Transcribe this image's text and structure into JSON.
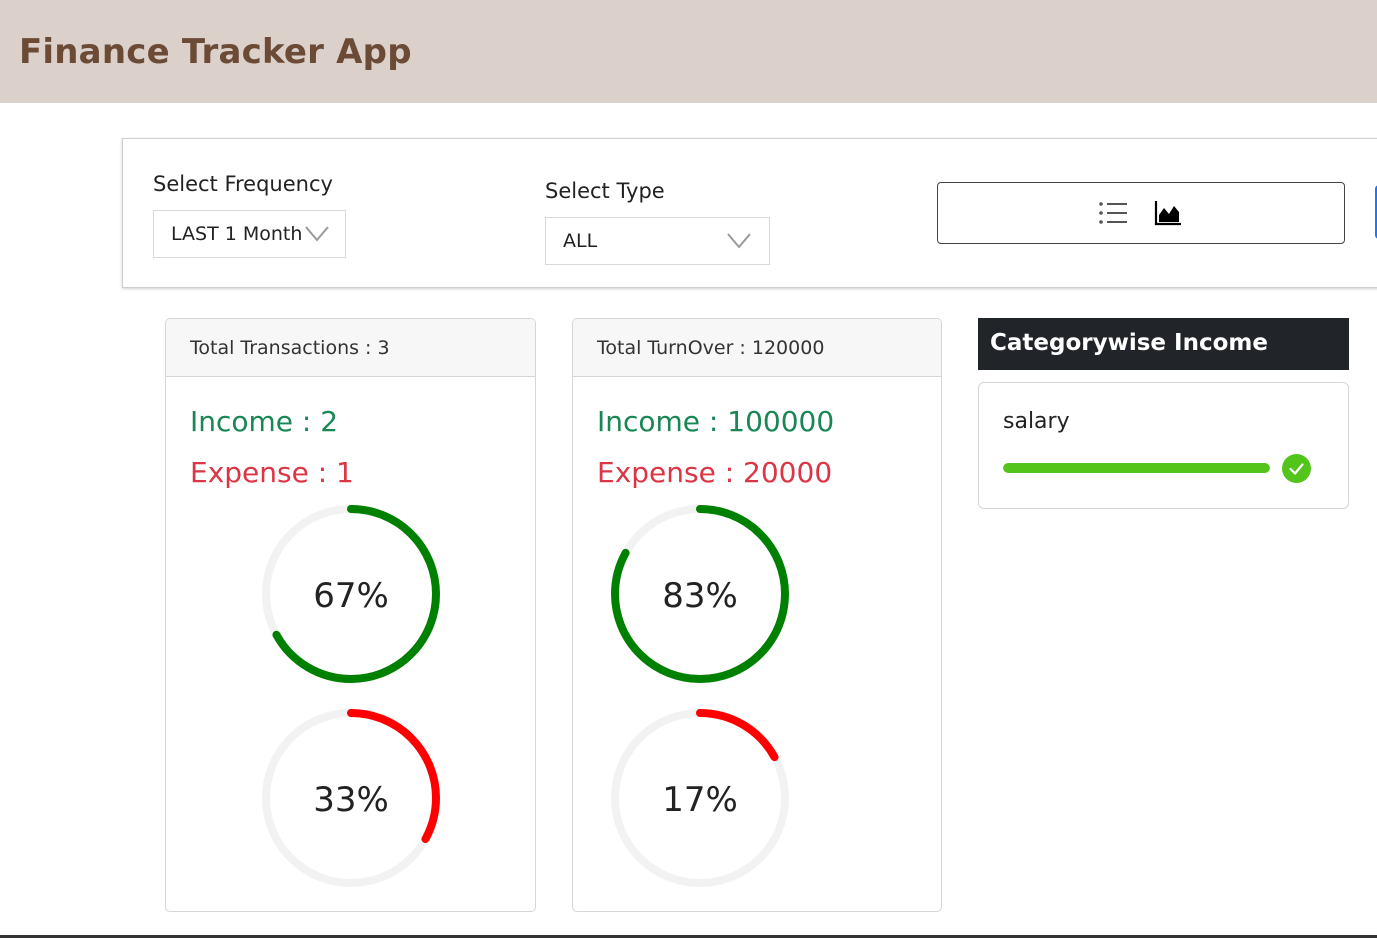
{
  "header": {
    "title": "Finance Tracker App"
  },
  "filters": {
    "frequency_label": "Select Frequency",
    "frequency_value": "LAST 1 Month",
    "type_label": "Select Type",
    "type_value": "ALL",
    "view_icons": [
      "unordered-list-icon",
      "area-chart-icon"
    ]
  },
  "transactions_card": {
    "header": "Total Transactions : 3",
    "income": "Income : 2",
    "expense": "Expense : 1",
    "income_percent": 67,
    "income_percent_label": "67%",
    "expense_percent": 33,
    "expense_percent_label": "33%"
  },
  "turnover_card": {
    "header": "Total TurnOver : 120000",
    "income": "Income : 100000",
    "expense": "Expense : 20000",
    "income_percent": 83,
    "income_percent_label": "83%",
    "expense_percent": 17,
    "expense_percent_label": "17%"
  },
  "category_income": {
    "title": "Categorywise Income",
    "items": [
      {
        "name": "salary",
        "percent": 100
      }
    ]
  },
  "colors": {
    "income_ring": "#008000",
    "expense_ring": "#ff0000",
    "ring_track": "#f2f2f2",
    "income_text": "#198754",
    "expense_text": "#dc3545",
    "category_bar": "#52c41a",
    "header_bg": "#dbd0ca",
    "title_color": "#6b4a36"
  }
}
